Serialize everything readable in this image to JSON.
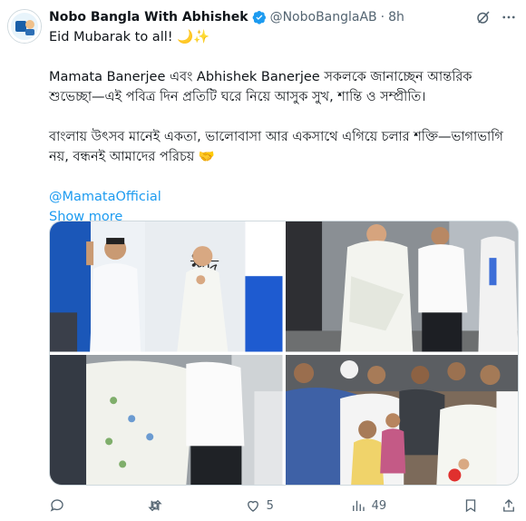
{
  "author": {
    "name": "Nobo Bangla With Abhishek",
    "handle": "@NoboBanglaAB",
    "separator": "·",
    "time": "8h"
  },
  "tweet": {
    "line1": "Eid Mubarak to all! 🌙✨",
    "line2": "Mamata Banerjee এবং Abhishek Banerjee সকলকে জানাচ্ছেন আন্তরিক শুভেচ্ছা—এই পবিত্র দিন প্রতিটি ঘরে নিয়ে আসুক সুখ, শান্তি ও সম্প্রীতি।",
    "line3": "বাংলায় উৎসব মানেই একতা, ভালোবাসা আর একসাথে এগিয়ে চলার শক্তি—ভাগাভাগি নয়, বন্ধনই আমাদের পরিচয় 🤝",
    "mention": "@MamataOfficial",
    "show_more": "Show more"
  },
  "actions": {
    "replies": "",
    "reposts": "",
    "likes": "5",
    "views": "49"
  },
  "colors": {
    "accent": "#1d9bf0",
    "muted": "#536471"
  },
  "icons": [
    "verified-badge-icon",
    "grok-icon",
    "more-icon",
    "reply-icon",
    "repost-icon",
    "like-icon",
    "views-icon",
    "bookmark-icon",
    "share-icon"
  ]
}
